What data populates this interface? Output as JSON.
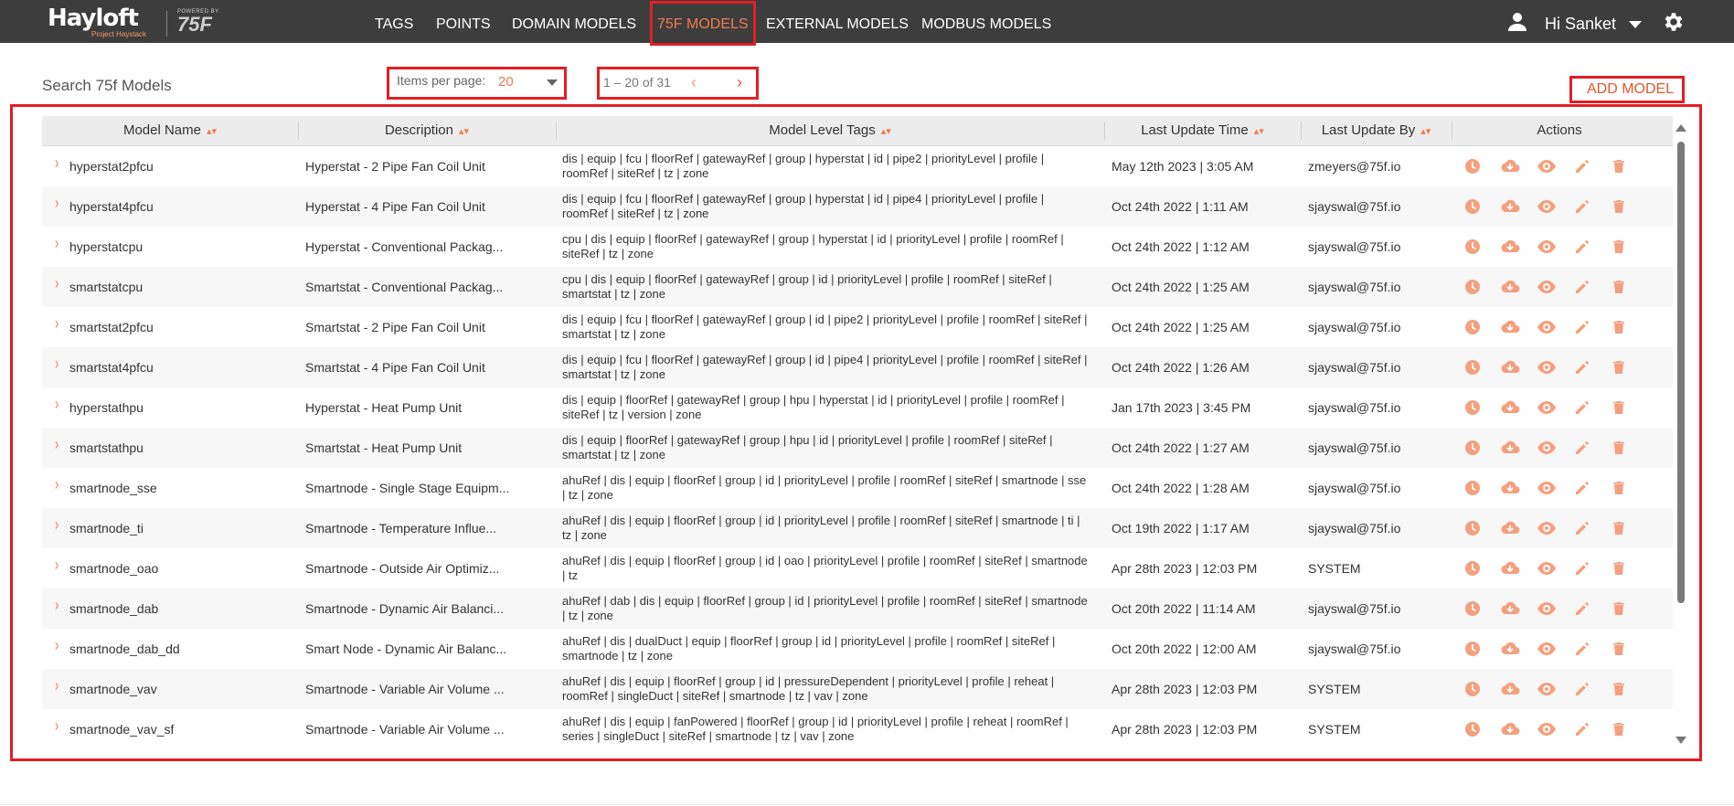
{
  "app": {
    "logo": "Hayloft",
    "logo_sub": "Project Haystack",
    "powered_by": "POWERED BY",
    "powered_brand": "75F"
  },
  "nav": {
    "tags": "TAGS",
    "points": "POINTS",
    "domain_models": "DOMAIN MODELS",
    "f75_models": "75F MODELS",
    "external_models": "EXTERNAL MODELS",
    "modbus_models": "MODBUS MODELS"
  },
  "user": {
    "greeting": "Hi Sanket"
  },
  "toolbar": {
    "search_title": "Search 75f Models",
    "items_per_page_label": "Items per page:",
    "items_per_page_value": "20",
    "range": "1 – 20 of 31",
    "add_model": "ADD MODEL"
  },
  "table": {
    "headers": {
      "name": "Model Name",
      "description": "Description",
      "tags": "Model Level Tags",
      "time": "Last Update Time",
      "by": "Last Update By",
      "actions": "Actions"
    },
    "rows": [
      {
        "name": "hyperstat2pfcu",
        "description": "Hyperstat - 2 Pipe Fan Coil Unit",
        "tags": "dis | equip | fcu | floorRef | gatewayRef | group | hyperstat | id | pipe2 | priorityLevel | profile | roomRef | siteRef | tz | zone",
        "time": "May 12th 2023 | 3:05 AM",
        "by": "zmeyers@75f.io"
      },
      {
        "name": "hyperstat4pfcu",
        "description": "Hyperstat - 4 Pipe Fan Coil Unit",
        "tags": "dis | equip | fcu | floorRef | gatewayRef | group | hyperstat | id | pipe4 | priorityLevel | profile | roomRef | siteRef | tz | zone",
        "time": "Oct 24th 2022 | 1:11 AM",
        "by": "sjayswal@75f.io"
      },
      {
        "name": "hyperstatcpu",
        "description": "Hyperstat - Conventional Packag...",
        "tags": "cpu | dis | equip | floorRef | gatewayRef | group | hyperstat | id | priorityLevel | profile | roomRef | siteRef | tz | zone",
        "time": "Oct 24th 2022 | 1:12 AM",
        "by": "sjayswal@75f.io"
      },
      {
        "name": "smartstatcpu",
        "description": "Smartstat - Conventional Packag...",
        "tags": "cpu | dis | equip | floorRef | gatewayRef | group | id | priorityLevel | profile | roomRef | siteRef | smartstat | tz | zone",
        "time": "Oct 24th 2022 | 1:25 AM",
        "by": "sjayswal@75f.io"
      },
      {
        "name": "smartstat2pfcu",
        "description": "Smartstat - 2 Pipe Fan Coil Unit",
        "tags": "dis | equip | fcu | floorRef | gatewayRef | group | id | pipe2 | priorityLevel | profile | roomRef | siteRef | smartstat | tz | zone",
        "time": "Oct 24th 2022 | 1:25 AM",
        "by": "sjayswal@75f.io"
      },
      {
        "name": "smartstat4pfcu",
        "description": "Smartstat - 4 Pipe Fan Coil Unit",
        "tags": "dis | equip | fcu | floorRef | gatewayRef | group | id | pipe4 | priorityLevel | profile | roomRef | siteRef | smartstat | tz | zone",
        "time": "Oct 24th 2022 | 1:26 AM",
        "by": "sjayswal@75f.io"
      },
      {
        "name": "hyperstathpu",
        "description": "Hyperstat - Heat Pump Unit",
        "tags": "dis | equip | floorRef | gatewayRef | group | hpu | hyperstat | id | priorityLevel | profile | roomRef | siteRef | tz | version | zone",
        "time": "Jan 17th 2023 | 3:45 PM",
        "by": "sjayswal@75f.io"
      },
      {
        "name": "smartstathpu",
        "description": "Smartstat - Heat Pump Unit",
        "tags": "dis | equip | floorRef | gatewayRef | group | hpu | id | priorityLevel | profile | roomRef | siteRef | smartstat | tz | zone",
        "time": "Oct 24th 2022 | 1:27 AM",
        "by": "sjayswal@75f.io"
      },
      {
        "name": "smartnode_sse",
        "description": "Smartnode - Single Stage Equipm...",
        "tags": "ahuRef | dis | equip | floorRef | group | id | priorityLevel | profile | roomRef | siteRef | smartnode | sse | tz | zone",
        "time": "Oct 24th 2022 | 1:28 AM",
        "by": "sjayswal@75f.io"
      },
      {
        "name": "smartnode_ti",
        "description": "Smartnode - Temperature Influe...",
        "tags": "ahuRef | dis | equip | floorRef | group | id | priorityLevel | profile | roomRef | siteRef | smartnode | ti | tz | zone",
        "time": "Oct 19th 2022 | 1:17 AM",
        "by": "sjayswal@75f.io"
      },
      {
        "name": "smartnode_oao",
        "description": "Smartnode - Outside Air Optimiz...",
        "tags": "ahuRef | dis | equip | floorRef | group | id | oao | priorityLevel | profile | roomRef | siteRef | smartnode | tz",
        "time": "Apr 28th 2023 | 12:03 PM",
        "by": "SYSTEM"
      },
      {
        "name": "smartnode_dab",
        "description": "Smartnode - Dynamic Air Balanci...",
        "tags": "ahuRef | dab | dis | equip | floorRef | group | id | priorityLevel | profile | roomRef | siteRef | smartnode | tz | zone",
        "time": "Oct 20th 2022 | 11:14 AM",
        "by": "sjayswal@75f.io"
      },
      {
        "name": "smartnode_dab_dd",
        "description": "Smart Node - Dynamic Air Balanc...",
        "tags": "ahuRef | dis | dualDuct | equip | floorRef | group | id | priorityLevel | profile | roomRef | siteRef | smartnode | tz | zone",
        "time": "Oct 20th 2022 | 12:00 AM",
        "by": "sjayswal@75f.io"
      },
      {
        "name": "smartnode_vav",
        "description": "Smartnode - Variable Air Volume ...",
        "tags": "ahuRef | dis | equip | floorRef | group | id | pressureDependent | priorityLevel | profile | reheat | roomRef | singleDuct | siteRef | smartnode | tz | vav | zone",
        "time": "Apr 28th 2023 | 12:03 PM",
        "by": "SYSTEM"
      },
      {
        "name": "smartnode_vav_sf",
        "description": "Smartnode - Variable Air Volume ...",
        "tags": "ahuRef | dis | equip | fanPowered | floorRef | group | id | priorityLevel | profile | reheat | roomRef | series | singleDuct | siteRef | smartnode | tz | vav | zone",
        "time": "Apr 28th 2023 | 12:03 PM",
        "by": "SYSTEM"
      }
    ]
  },
  "colors": {
    "accent": "#ef7b50",
    "nav_bg": "#3d3d3d",
    "highlight": "#e21e26"
  },
  "icons": [
    "user-icon",
    "chevron-down-icon",
    "gear-icon",
    "history-icon",
    "download-icon",
    "view-icon",
    "edit-icon",
    "delete-icon",
    "sort-icon",
    "expand-chevron-icon"
  ]
}
